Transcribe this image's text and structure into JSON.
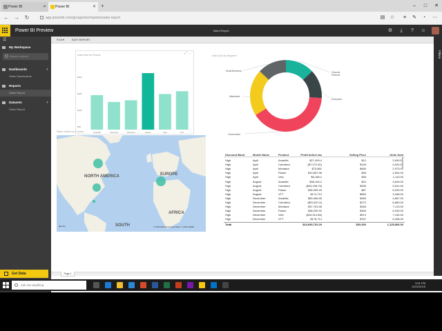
{
  "browser": {
    "tabs": [
      {
        "label": "Power BI"
      },
      {
        "label": "Power BI"
      }
    ],
    "new_tab": "+",
    "address": "app.powerbi.com/groups/me/reports/sales-report",
    "win_min": "–",
    "win_max": "□",
    "win_close": "✕"
  },
  "header": {
    "brand": "Power BI Preview",
    "report_name": "Sales Report"
  },
  "toolbar": {
    "file": "FILE",
    "file_caret": "▾",
    "edit_report": "EDIT REPORT"
  },
  "nav": {
    "my_workspace": "My Workspace",
    "search_placeholder": "Search content",
    "dashboards": "Dashboards",
    "dashboards_item": "Sales Dashboards",
    "reports": "Reports",
    "reports_item": "Sales Report",
    "datasets": "Datasets",
    "datasets_item": "Sales Report",
    "get_data": "Get Data"
  },
  "filters_label": "Filters",
  "bar_visual": {
    "title": "Units Sold by Product",
    "y_ticks": [
      "$200",
      "$150",
      "$100",
      "$50"
    ],
    "products": [
      "Amarilla",
      "Carretera",
      "Montana",
      "Paseo",
      "Velo",
      "VTT"
    ],
    "values": [
      0.61,
      0.49,
      0.52,
      1.0,
      0.63,
      0.68
    ],
    "highlight_index": 3,
    "bar_color": "#8fe1cc",
    "highlight_color": "#12b79a",
    "focus": "⤢",
    "more": "…"
  },
  "map_visual": {
    "title": "Sales Volume by Country",
    "labels": {
      "north_america": "NORTH AMERICA",
      "europe": "EUROPE",
      "africa": "AFRICA",
      "south": "SOUTH"
    },
    "attribution": "© 2015 Microsoft Corporation  © 2015 HERE"
  },
  "donut_visual": {
    "title": "Units Sold by Segment",
    "segments": [
      {
        "name": "Channel Partners",
        "share": 0.13,
        "color": "#19b39c"
      },
      {
        "name": "Enterprise",
        "share": 0.13,
        "color": "#3a4547"
      },
      {
        "name": "Government",
        "share": 0.4,
        "color": "#f0445c"
      },
      {
        "name": "Midmarket",
        "share": 0.21,
        "color": "#f2cb1d"
      },
      {
        "name": "Small Business",
        "share": 0.13,
        "color": "#5f6466"
      }
    ]
  },
  "table_visual": {
    "columns": [
      "Discount Band",
      "Month Name",
      "Product",
      "Profit before tax",
      "Selling Price",
      "Units Sold"
    ],
    "rows": [
      [
        "High",
        "April",
        "Amarilla",
        "$27,409.4",
        "$12",
        "3,539.50"
      ],
      [
        "High",
        "April",
        "Carretera",
        "($7,272.40)",
        "$145",
        "4,024.50"
      ],
      [
        "High",
        "April",
        "Montana",
        "$73,881",
        "$650",
        "2,973.00"
      ],
      [
        "High",
        "April",
        "Paseo",
        "$10,667.98",
        "$36",
        "2,904.00"
      ],
      [
        "High",
        "April",
        "Velo",
        "$6,168.2",
        "$35",
        "1,110.00"
      ],
      [
        "High",
        "August",
        "Amarilla",
        "$38,194.2",
        "$24",
        "3,649.00"
      ],
      [
        "High",
        "August",
        "Carretera",
        "($34,198.75)",
        "$256",
        "3,941.00"
      ],
      [
        "High",
        "August",
        "Paseo",
        "$35,395.49",
        "$87",
        "6,033.00"
      ],
      [
        "High",
        "August",
        "VTT",
        "$174,713",
        "$650",
        "3,348.00"
      ],
      [
        "High",
        "December",
        "Amarilla",
        "$59,456.55",
        "$350",
        "4,867.00"
      ],
      [
        "High",
        "December",
        "Carretera",
        "($29,621.5)",
        "$272",
        "6,883.00"
      ],
      [
        "High",
        "December",
        "Montana",
        "$37,751.56",
        "$346",
        "7,113.00"
      ],
      [
        "High",
        "December",
        "Paseo",
        "$38,290.92",
        "$300",
        "5,349.00"
      ],
      [
        "High",
        "December",
        "Velo",
        "($16,314.56)",
        "$574",
        "7,154.00"
      ],
      [
        "High",
        "December",
        "VTT",
        "$178,714",
        "$767",
        "5,498.00"
      ]
    ],
    "total": [
      "Total",
      "",
      "",
      "$16,893,702.29",
      "$52,000",
      "1,125,806.00"
    ]
  },
  "page_tab": "Page 1",
  "taskbar": {
    "search_placeholder": "Ask me anything",
    "time": "3:41 PM",
    "date": "10/22/2015"
  }
}
